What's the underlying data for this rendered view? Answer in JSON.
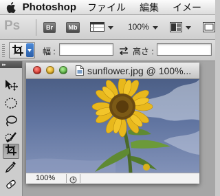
{
  "menubar": {
    "app_name": "Photoshop",
    "items": [
      "ファイル",
      "編集",
      "イメー"
    ]
  },
  "appbar": {
    "ps_label": "Ps",
    "bridge_label": "Br",
    "minibridge_label": "Mb",
    "zoom_value": "100%"
  },
  "options": {
    "width_label": "幅 :",
    "height_label": "高さ :",
    "width_value": "",
    "height_value": ""
  },
  "document": {
    "title": "sunflower.jpg @ 100%...",
    "zoom_status": "100%"
  },
  "icons": {
    "apple": "apple-icon",
    "crop": "crop-icon",
    "swap": "swap-arrows-icon",
    "move": "move-icon",
    "marquee": "elliptical-marquee-icon",
    "lasso": "lasso-icon",
    "quick_select": "quick-selection-icon",
    "eyedropper": "eyedropper-icon",
    "healing": "healing-brush-icon"
  },
  "colors": {
    "close_light": "#e0443a",
    "minimize_light": "#e6b52b",
    "zoom_light": "#62b94a"
  }
}
